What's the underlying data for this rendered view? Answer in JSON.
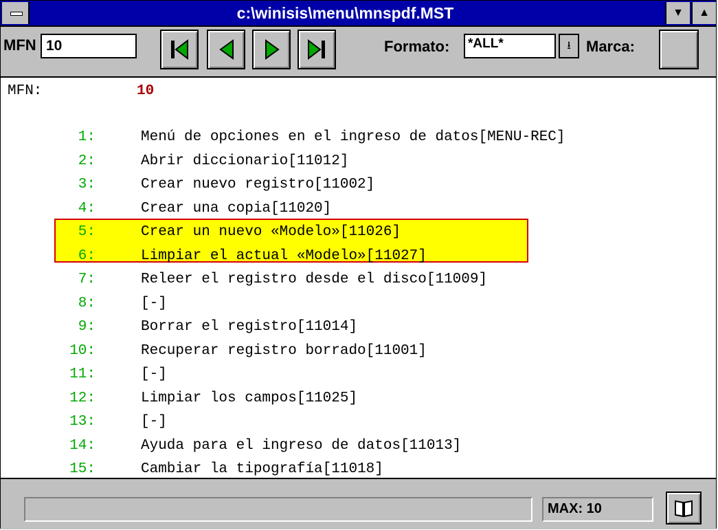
{
  "window": {
    "title": "c:\\winisis\\menu\\mnspdf.MST"
  },
  "toolbar": {
    "mfn_label": "MFN",
    "mfn_value": "10",
    "formato_label": "Formato:",
    "formato_value": "*ALL*",
    "marca_label": "Marca:"
  },
  "record": {
    "mfn_label": "MFN:",
    "mfn_value": "10",
    "lines": [
      {
        "num": "1:",
        "text": "Menú de opciones en el ingreso de datos[MENU-REC]"
      },
      {
        "num": "2:",
        "text": "Abrir diccionario[11012]"
      },
      {
        "num": "3:",
        "text": "Crear nuevo registro[11002]"
      },
      {
        "num": "4:",
        "text": "Crear una copia[11020]"
      },
      {
        "num": "5:",
        "text": "Crear un nuevo «Modelo»[11026]"
      },
      {
        "num": "6:",
        "text": "Limpiar el actual «Modelo»[11027]"
      },
      {
        "num": "7:",
        "text": "Releer el registro desde el disco[11009]"
      },
      {
        "num": "8:",
        "text": "[-]"
      },
      {
        "num": "9:",
        "text": "Borrar el registro[11014]"
      },
      {
        "num": "10:",
        "text": "Recuperar registro borrado[11001]"
      },
      {
        "num": "11:",
        "text": "[-]"
      },
      {
        "num": "12:",
        "text": "Limpiar los campos[11025]"
      },
      {
        "num": "13:",
        "text": "[-]"
      },
      {
        "num": "14:",
        "text": "Ayuda para el ingreso de datos[11013]"
      },
      {
        "num": "15:",
        "text": "Cambiar la tipografía[11018]"
      }
    ]
  },
  "status": {
    "max_label": "MAX: 10"
  },
  "colors": {
    "titlebar": "#0000a8",
    "line_number": "#00a800",
    "mfn_value": "#a80000",
    "highlight": "#ffff00",
    "highlight_border": "#d40000"
  },
  "icons": [
    "system-menu-icon",
    "first-record-icon",
    "previous-record-icon",
    "next-record-icon",
    "last-record-icon",
    "dropdown-arrow-icon",
    "book-icon"
  ]
}
